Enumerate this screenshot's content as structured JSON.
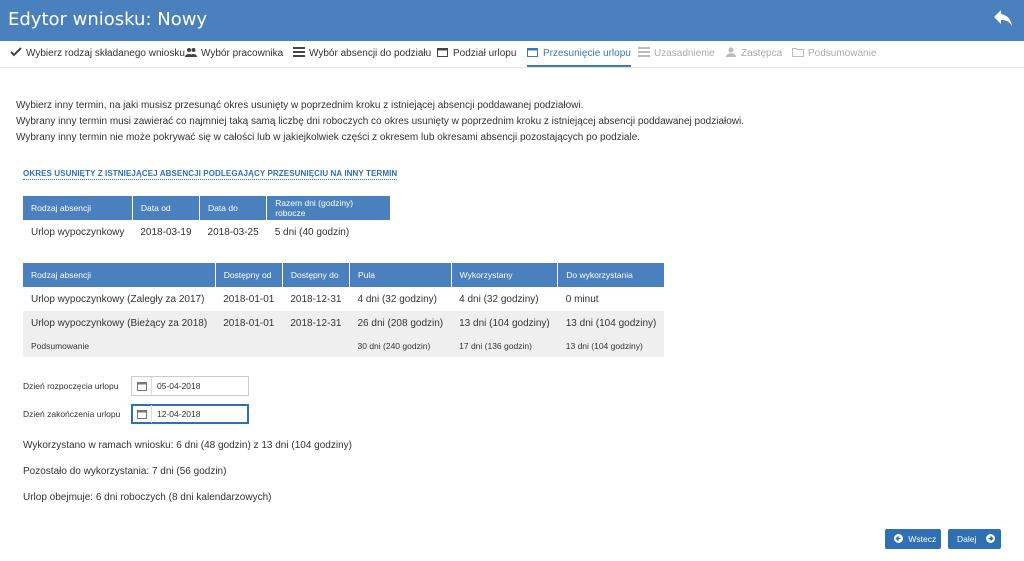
{
  "header": {
    "title": "Edytor wniosku: Nowy",
    "back_icon": "reply-arrow-icon"
  },
  "wizard": {
    "steps": [
      {
        "label": "Wybierz rodzaj składanego wniosku",
        "icon": "check-icon",
        "state": "done"
      },
      {
        "label": "Wybór pracownika",
        "icon": "users-icon",
        "state": "done"
      },
      {
        "label": "Wybór absencji do podziału",
        "icon": "list-icon",
        "state": "done"
      },
      {
        "label": "Podział urlopu",
        "icon": "calendar-icon",
        "state": "done"
      },
      {
        "label": "Przesunięcie urlopu",
        "icon": "calendar-icon",
        "state": "active"
      },
      {
        "label": "Uzasadnienie",
        "icon": "list-icon",
        "state": "disabled"
      },
      {
        "label": "Zastępca",
        "icon": "user-icon",
        "state": "disabled"
      },
      {
        "label": "Podsumowanie",
        "icon": "folder-icon",
        "state": "disabled"
      }
    ]
  },
  "intro": {
    "line1": "Wybierz inny termin, na jaki musisz przesunąć okres usunięty w poprzednim kroku z istniejącej absencji poddawanej podziałowi.",
    "line2": "Wybrany inny termin musi zawierać co najmniej taką samą liczbę dni roboczych co okres usunięty w poprzednim kroku z istniejącej absencji poddawanej podziałowi.",
    "line3": "Wybrany inny termin nie może pokrywać się w całości lub w jakiejkolwiek części z okresem lub okresami absencji pozostających po podziale."
  },
  "section_title": "OKRES USUNIĘTY Z ISTNIEJĄCEJ ABSENCJI PODLEGAJĄCY PRZESUNIĘCIU NA INNY TERMIN",
  "removed_table": {
    "headers": [
      "Rodzaj absencji",
      "Data od",
      "Data do",
      "Razem dni (godziny) robocze"
    ],
    "row": [
      "Urlop wypoczynkowy",
      "2018-03-19",
      "2018-03-25",
      "5 dni (40 godzin)"
    ]
  },
  "pool_table": {
    "headers": [
      "Rodzaj absencji",
      "Dostępny od",
      "Dostępny do",
      "Pula",
      "Wykorzystany",
      "Do wykorzystania"
    ],
    "rows": [
      [
        "Urlop wypoczynkowy (Zaległy za 2017)",
        "2018-01-01",
        "2018-12-31",
        "4 dni (32 godziny)",
        "4 dni (32 godziny)",
        "0 minut"
      ],
      [
        "Urlop wypoczynkowy (Bieżący za 2018)",
        "2018-01-01",
        "2018-12-31",
        "26 dni (208 godzin)",
        "13 dni (104 godziny)",
        "13 dni (104 godziny)"
      ]
    ],
    "summary": [
      "Podsumowanie",
      "",
      "",
      "30 dni (240 godzin)",
      "17 dni (136 godzin)",
      "13 dni (104 godziny)"
    ]
  },
  "form": {
    "start_label": "Dzień rozpoczęcia urlopu",
    "start_value": "05-04-2018",
    "end_label": "Dzień zakończenia urlopu",
    "end_value": "12-04-2018"
  },
  "info": {
    "used": "Wykorzystano w ramach wniosku: 6 dni (48 godzin) z 13 dni (104 godziny)",
    "remaining": "Pozostało do wykorzystania: 7 dni (56 godzin)",
    "covers": "Urlop obejmuje: 6 dni roboczych (8 dni kalendarzowych)"
  },
  "buttons": {
    "back": "Wstecz",
    "next": "Dalej"
  },
  "colors": {
    "header": "#4a80bd",
    "accent": "#2f6fb3",
    "table_header": "#4a80bd"
  }
}
